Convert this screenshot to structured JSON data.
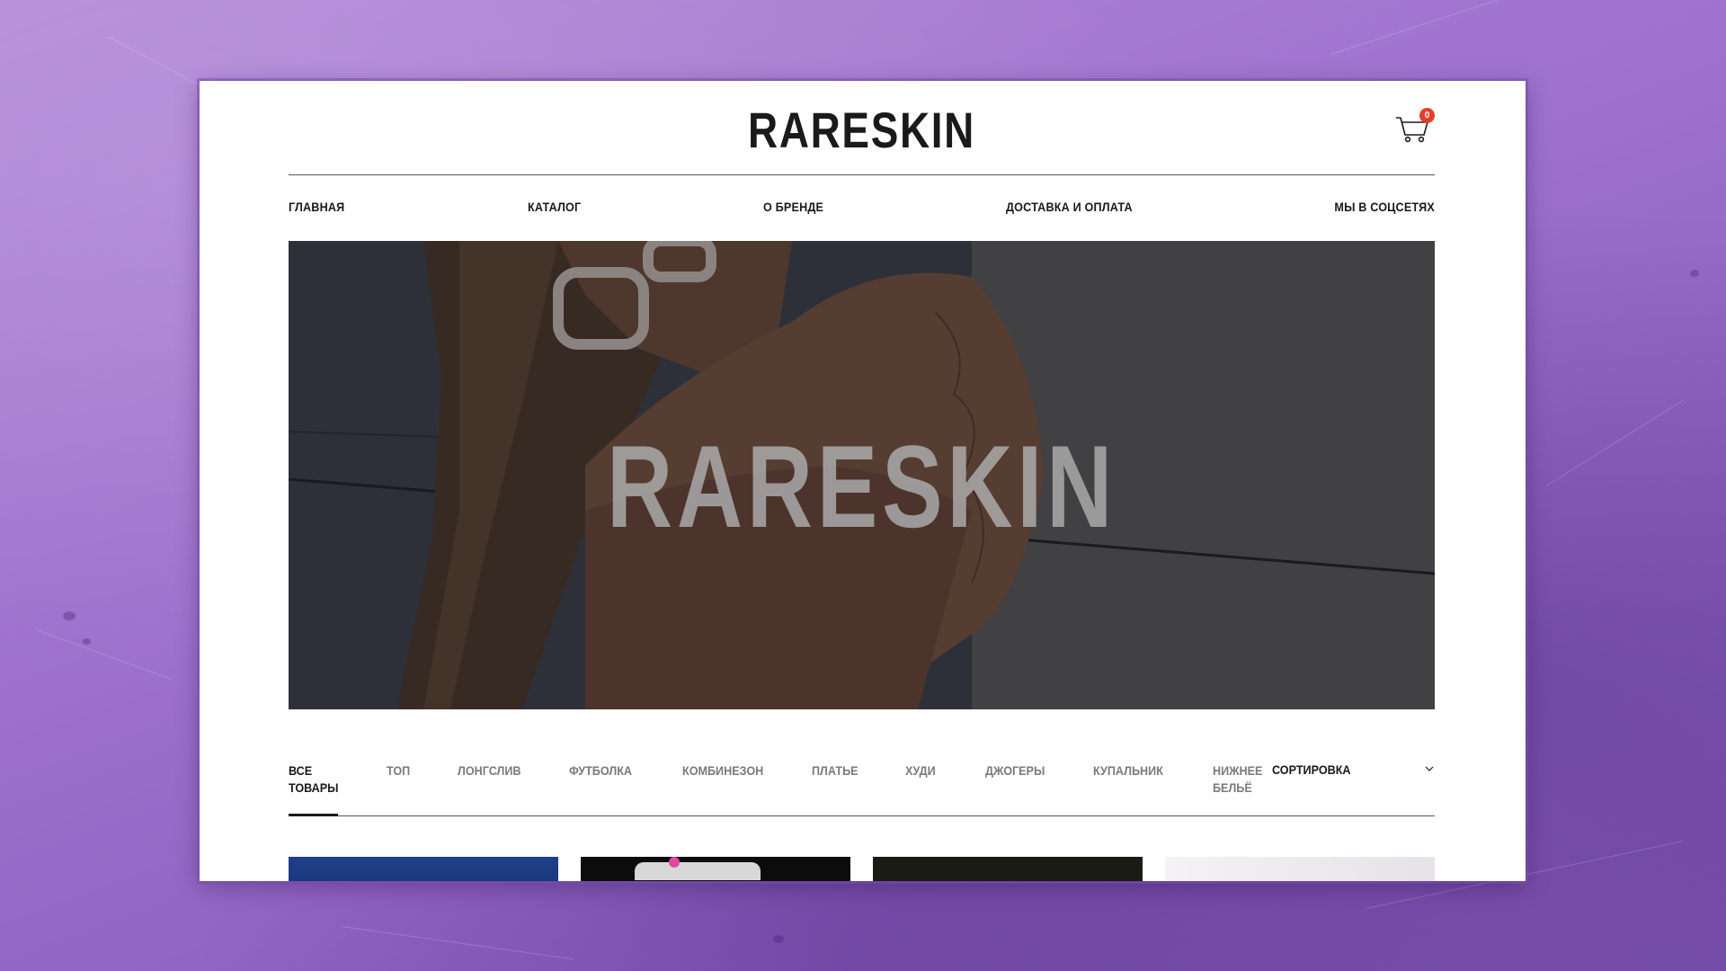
{
  "header": {
    "logo": "RARESKIN",
    "cart_count": "0"
  },
  "nav": {
    "items": [
      {
        "label": "ГЛАВНАЯ"
      },
      {
        "label": "КАТАЛОГ"
      },
      {
        "label": "О БРЕНДЕ"
      },
      {
        "label": "ДОСТАВКА И ОПЛАТА"
      },
      {
        "label": "МЫ В СОЦСЕТЯХ"
      }
    ]
  },
  "hero": {
    "title": "RARESKIN"
  },
  "filters": {
    "tabs": [
      {
        "label": "ВСЕ\nТОВАРЫ",
        "active": true
      },
      {
        "label": "ТОП",
        "active": false
      },
      {
        "label": "ЛОНГСЛИВ",
        "active": false
      },
      {
        "label": "ФУТБОЛКА",
        "active": false
      },
      {
        "label": "КОМБИНЕЗОН",
        "active": false
      },
      {
        "label": "ПЛАТЬЕ",
        "active": false
      },
      {
        "label": "ХУДИ",
        "active": false
      },
      {
        "label": "ДЖОГЕРЫ",
        "active": false
      },
      {
        "label": "КУПАЛЬНИК",
        "active": false
      },
      {
        "label": "НИЖНЕЕ\nБЕЛЬЁ",
        "active": false
      }
    ],
    "sort_label": "СОРТИРОВКА"
  },
  "colors": {
    "accent_badge": "#e0402a",
    "text_primary": "#1a1a1a",
    "text_muted": "#7a7a7a",
    "background_purple": "#a175cf"
  }
}
